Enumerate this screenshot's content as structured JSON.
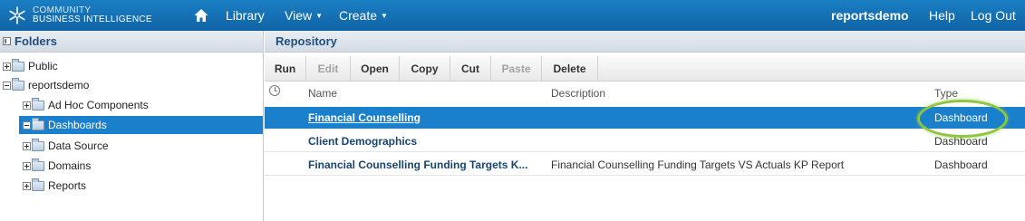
{
  "brand": {
    "line1": "COMMUNITY",
    "line2": "BUSINESS INTELLIGENCE",
    "logo_icon": "snowflake-logo-icon"
  },
  "nav": {
    "home_icon": "home-icon",
    "library": "Library",
    "view": "View",
    "create": "Create",
    "user": "reportsdemo",
    "help": "Help",
    "logout": "Log Out"
  },
  "folders": {
    "title": "Folders",
    "items": [
      {
        "label": "Public",
        "expanded": false
      },
      {
        "label": "reportsdemo",
        "expanded": true
      },
      {
        "label": "Ad Hoc Components",
        "expanded": false
      },
      {
        "label": "Dashboards",
        "expanded": true,
        "selected": true
      },
      {
        "label": "Data Source",
        "expanded": false
      },
      {
        "label": "Domains",
        "expanded": false
      },
      {
        "label": "Reports",
        "expanded": false
      }
    ]
  },
  "repository": {
    "title": "Repository",
    "toolbar": {
      "run": "Run",
      "edit": "Edit",
      "open": "Open",
      "copy": "Copy",
      "cut": "Cut",
      "paste": "Paste",
      "delete": "Delete"
    },
    "columns": {
      "name": "Name",
      "description": "Description",
      "type": "Type"
    },
    "rows": [
      {
        "name": "Financial Counselling",
        "description": "",
        "type": "Dashboard",
        "selected": true
      },
      {
        "name": "Client Demographics",
        "description": "",
        "type": "Dashboard"
      },
      {
        "name": "Financial Counselling Funding Targets K...",
        "description": "Financial Counselling Funding Targets VS Actuals KP Report",
        "type": "Dashboard"
      }
    ]
  },
  "colors": {
    "topbar": "#1476bb",
    "selection": "#1b80cc",
    "highlight_ring": "#8dc63f",
    "link": "#17466f"
  }
}
